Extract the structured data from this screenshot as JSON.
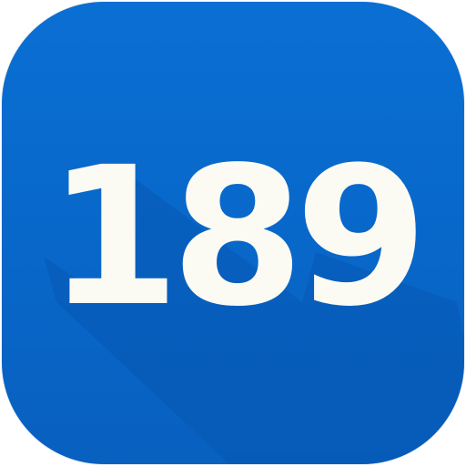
{
  "icon": {
    "label": "189",
    "background_color": "#0868cc",
    "shadow_color": "#0756ad",
    "text_color": "#fbfaf3"
  }
}
